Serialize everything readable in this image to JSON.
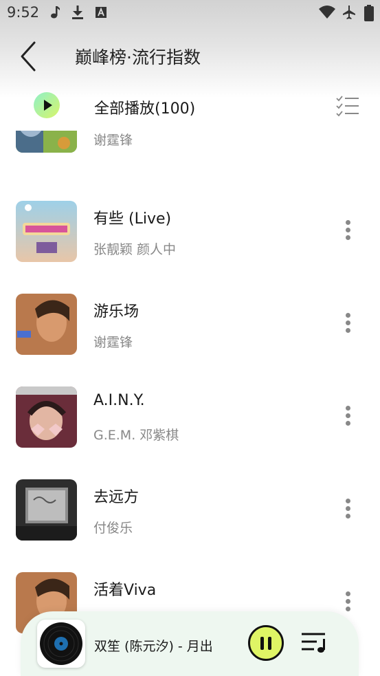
{
  "status_bar": {
    "time": "9:52",
    "icons": [
      "music-note-icon",
      "download-icon",
      "a-letter-icon",
      "wifi-icon",
      "airplane-icon",
      "battery-icon"
    ]
  },
  "header": {
    "title": "巅峰榜·流行指数"
  },
  "play_all": {
    "label": "全部播放(100)"
  },
  "songs": [
    {
      "title": "",
      "artist": "谢霆锋"
    },
    {
      "title": "有些 (Live)",
      "artist": "张靓颖 颜人中"
    },
    {
      "title": "游乐场",
      "artist": "谢霆锋"
    },
    {
      "title": "A.I.N.Y.",
      "artist": "G.E.M. 邓紫棋"
    },
    {
      "title": "去远方",
      "artist": "付俊乐"
    },
    {
      "title": "活着Viva",
      "artist": ""
    }
  ],
  "player": {
    "now_playing": "双笙 (陈元汐) - 月出"
  },
  "colors": {
    "accent": "#dff565",
    "player_bg": "#eef7f0"
  }
}
